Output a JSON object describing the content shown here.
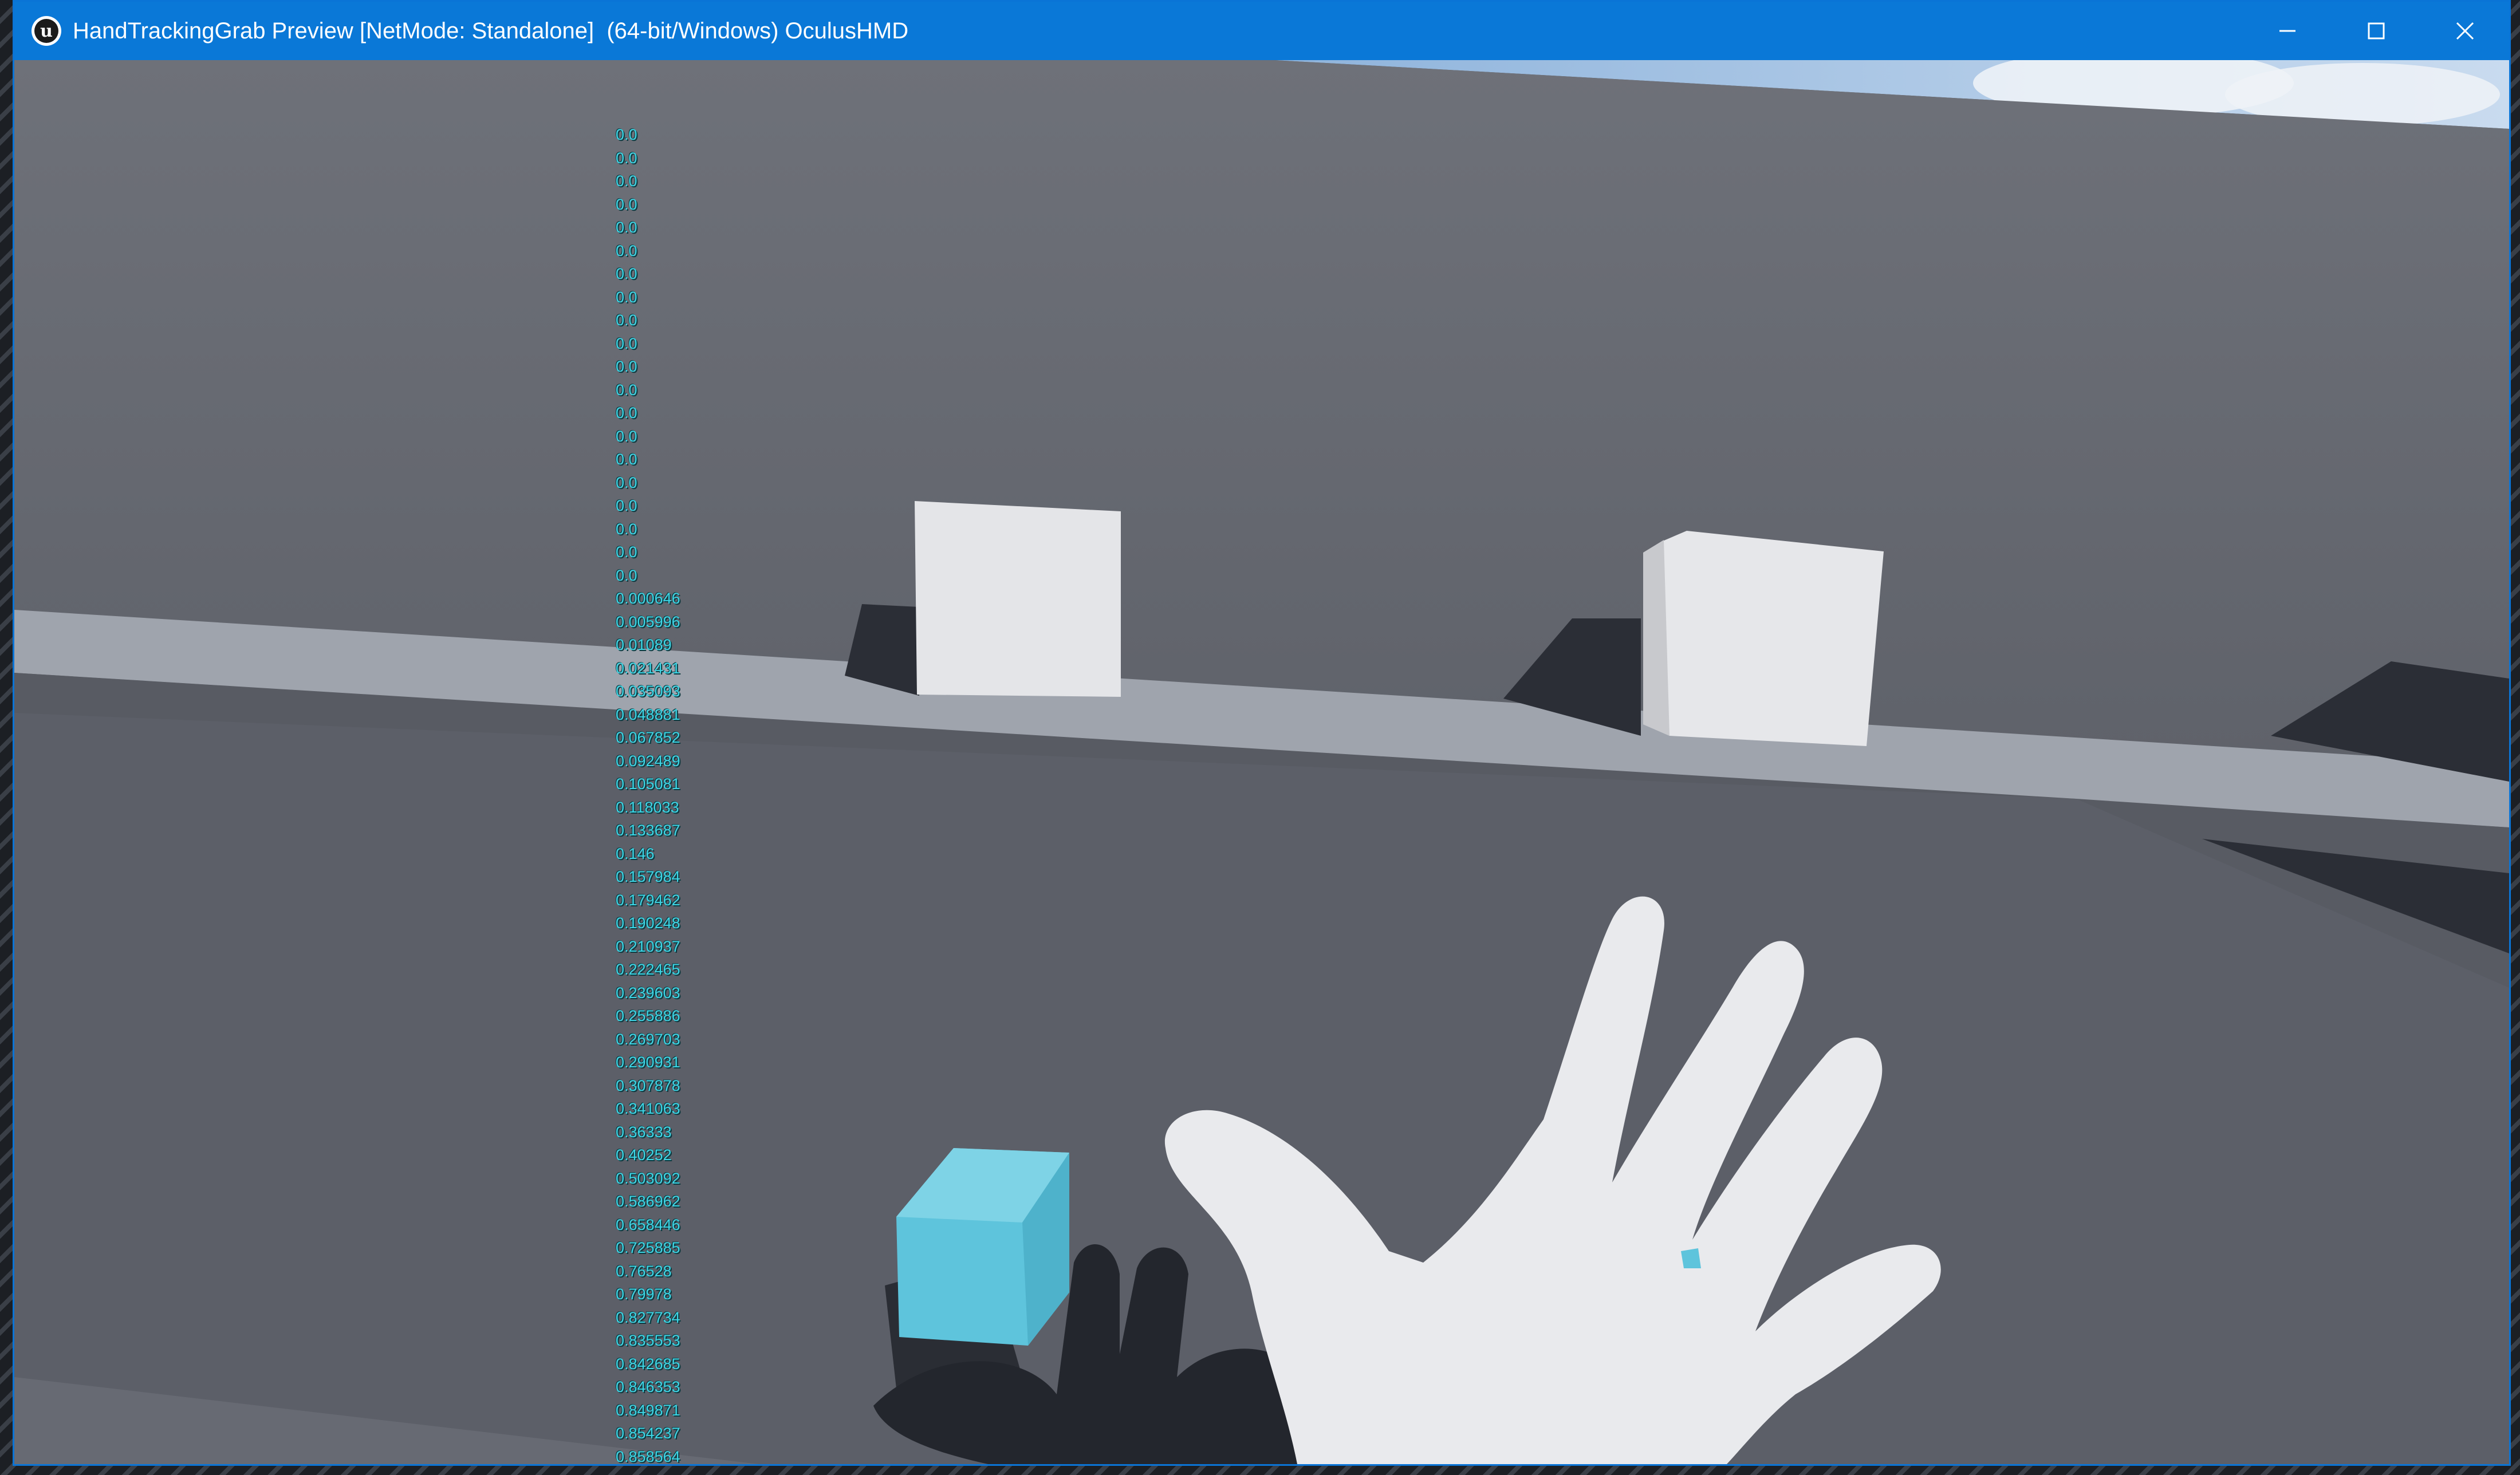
{
  "window": {
    "title": "HandTrackingGrab Preview [NetMode: Standalone]  (64-bit/Windows) OculusHMD",
    "app_icon": "unreal-engine-logo-icon",
    "controls": {
      "minimize": "minimize-icon",
      "maximize": "maximize-icon",
      "close": "close-icon"
    }
  },
  "scene": {
    "description_icons": [
      "white-cube",
      "white-cube",
      "cyan-cube",
      "virtual-hand"
    ],
    "colors": {
      "wall": "#6a6e77",
      "ledge": "#9aa0aa",
      "floor": "#5a5d66",
      "white_cube": "#e6e7ea",
      "cyan_cube": "#5fc6dd",
      "hand": "#e8e9ec",
      "debug_text": "#3fd6e6"
    }
  },
  "debug_values": [
    "0.0",
    "0.0",
    "0.0",
    "0.0",
    "0.0",
    "0.0",
    "0.0",
    "0.0",
    "0.0",
    "0.0",
    "0.0",
    "0.0",
    "0.0",
    "0.0",
    "0.0",
    "0.0",
    "0.0",
    "0.0",
    "0.0",
    "0.0",
    "0.000646",
    "0.005996",
    "0.01089",
    "0.021431",
    "0.035093",
    "0.048881",
    "0.067852",
    "0.092489",
    "0.105081",
    "0.118033",
    "0.133687",
    "0.146",
    "0.157984",
    "0.179462",
    "0.190248",
    "0.210937",
    "0.222465",
    "0.239603",
    "0.255886",
    "0.269703",
    "0.290931",
    "0.307878",
    "0.341063",
    "0.36333",
    "0.40252",
    "0.503092",
    "0.586962",
    "0.658446",
    "0.725885",
    "0.76528",
    "0.79978",
    "0.827734",
    "0.835553",
    "0.842685",
    "0.846353",
    "0.849871",
    "0.854237",
    "0.858564"
  ]
}
